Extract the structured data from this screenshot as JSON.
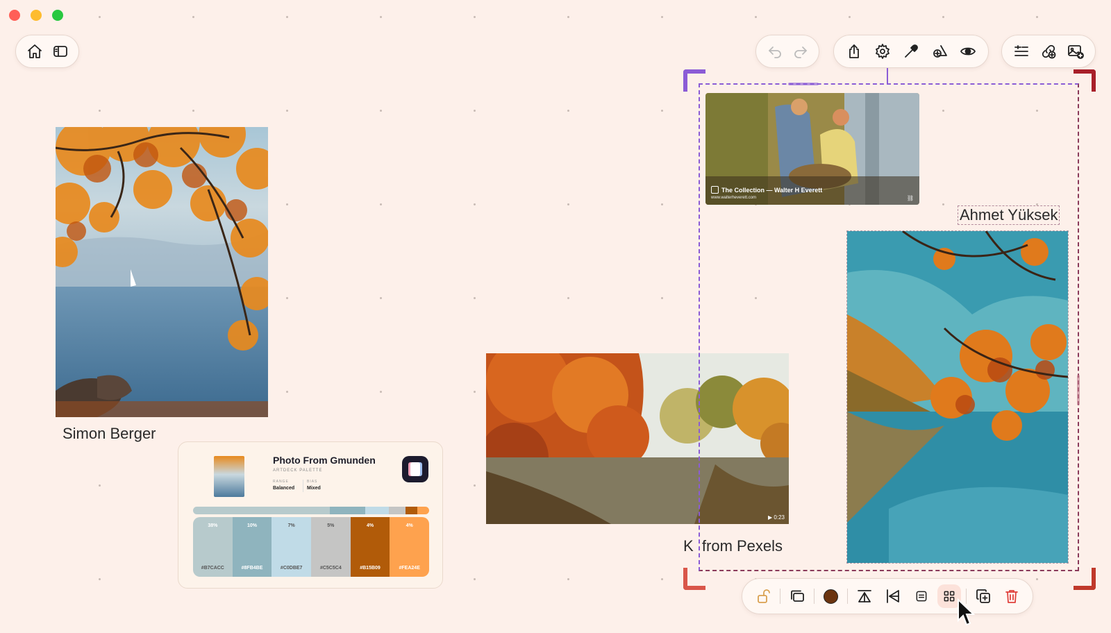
{
  "window": {
    "controls": [
      {
        "name": "close",
        "color": "#ff5f57"
      },
      {
        "name": "minimize",
        "color": "#febc2e"
      },
      {
        "name": "zoom",
        "color": "#28c840"
      }
    ]
  },
  "toolbar_left": [
    "home-icon",
    "sidebar-icon"
  ],
  "toolbar_history": [
    "undo-icon",
    "redo-icon"
  ],
  "toolbar_main": [
    "share-icon",
    "gear-icon",
    "eyedropper-icon",
    "add-shape-icon",
    "eye-icon"
  ],
  "toolbar_right": [
    "add-text-icon",
    "add-link-icon",
    "add-image-icon"
  ],
  "captions": {
    "simon": "Simon Berger",
    "ahmet": "Ahmet Yüksek",
    "pexels": "K  from Pexels"
  },
  "link_card": {
    "title": "The Collection — Walter H Everett",
    "url": "www.walterheverett.com"
  },
  "video": {
    "duration": "▶ 0:23"
  },
  "palette": {
    "title": "Photo From Gmunden",
    "subtitle": "ARTDECK PALETTE",
    "range_label": "RANGE",
    "range_value": "Balanced",
    "bias_label": "BIAS",
    "bias_value": "Mixed",
    "swatches": [
      {
        "pct": "38%",
        "hex": "#B7CACC",
        "color": "#b7cacc"
      },
      {
        "pct": "10%",
        "hex": "#8FB4BE",
        "color": "#8fb4be"
      },
      {
        "pct": "7%",
        "hex": "#C0DBE7",
        "color": "#c0dbe7"
      },
      {
        "pct": "5%",
        "hex": "#C5C5C4",
        "color": "#c5c5c4"
      },
      {
        "pct": "4%",
        "hex": "#B15B09",
        "color": "#b15b09"
      },
      {
        "pct": "4%",
        "hex": "#FEA24E",
        "color": "#fea24e"
      }
    ],
    "bar_fractions": [
      0.38,
      0.1,
      0.07,
      0.05,
      0.04,
      0.04
    ]
  },
  "bottom_toolbar": [
    "unlock-icon",
    "layers-icon",
    "color-icon",
    "flip-vertical-icon",
    "flip-horizontal-icon",
    "align-icon",
    "grid-icon",
    "duplicate-icon",
    "trash-icon"
  ],
  "colors": {
    "selection_purple": "#8b5cd6",
    "selection_red": "#c0392b",
    "background": "#fdf0ea",
    "fill_chip": "#6b3410",
    "trash": "#e0413c"
  }
}
